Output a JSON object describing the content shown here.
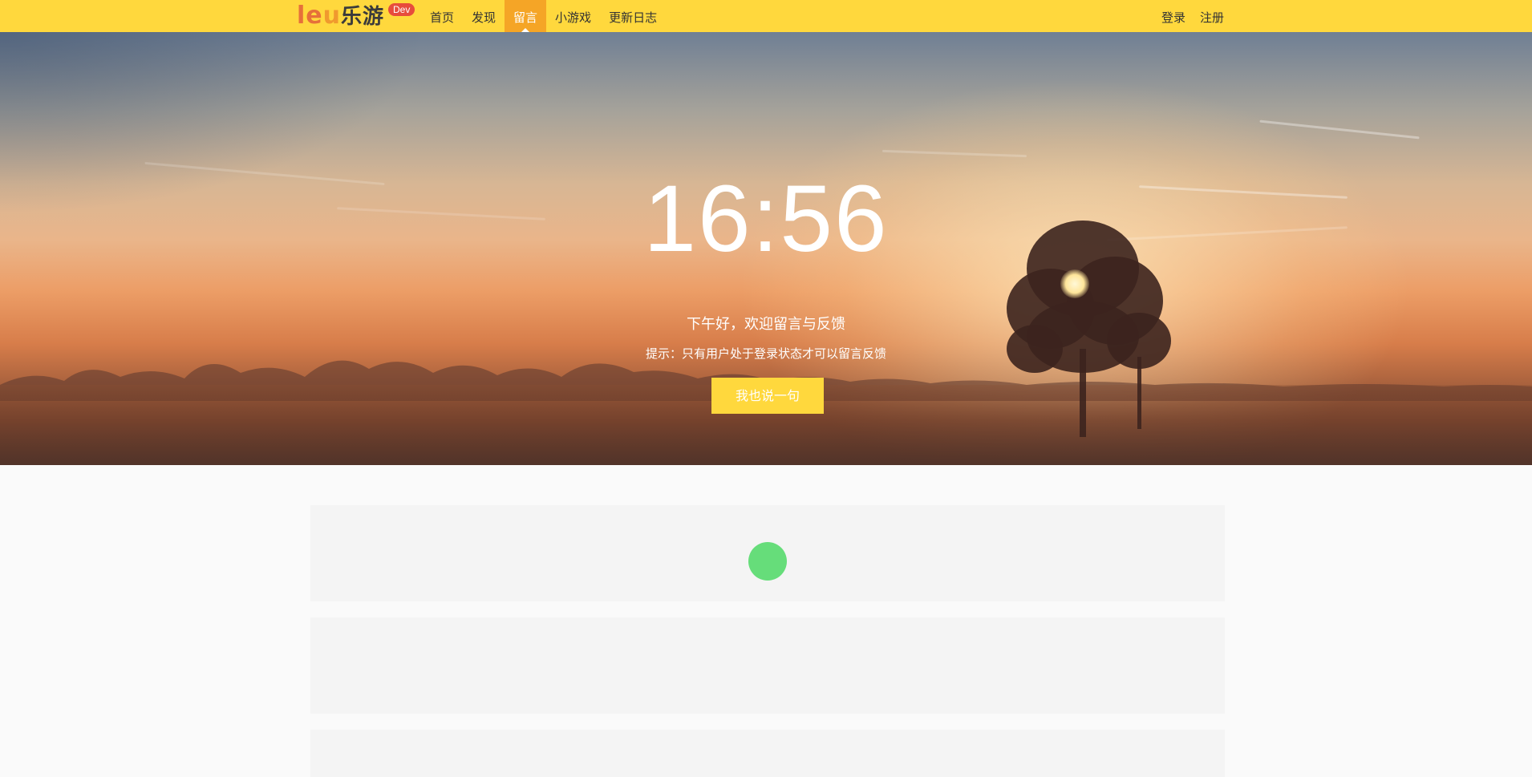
{
  "header": {
    "logo": {
      "part1": "le",
      "part2": "u",
      "part3": "乐游",
      "badge": "Dev"
    },
    "nav": [
      {
        "label": "首页",
        "active": false
      },
      {
        "label": "发现",
        "active": false
      },
      {
        "label": "留言",
        "active": true
      },
      {
        "label": "小游戏",
        "active": false
      },
      {
        "label": "更新日志",
        "active": false
      }
    ],
    "auth": {
      "login": "登录",
      "register": "注册"
    }
  },
  "hero": {
    "time": "16:56",
    "greeting": "下午好，欢迎留言与反馈",
    "tip": "提示：只有用户处于登录状态才可以留言反馈",
    "button": "我也说一句"
  },
  "colors": {
    "topbar": "#ffd83d",
    "nav_active": "#f5a526",
    "button": "#ffd83d",
    "spinner": "#66dd7a",
    "badge": "#e74c3c"
  }
}
